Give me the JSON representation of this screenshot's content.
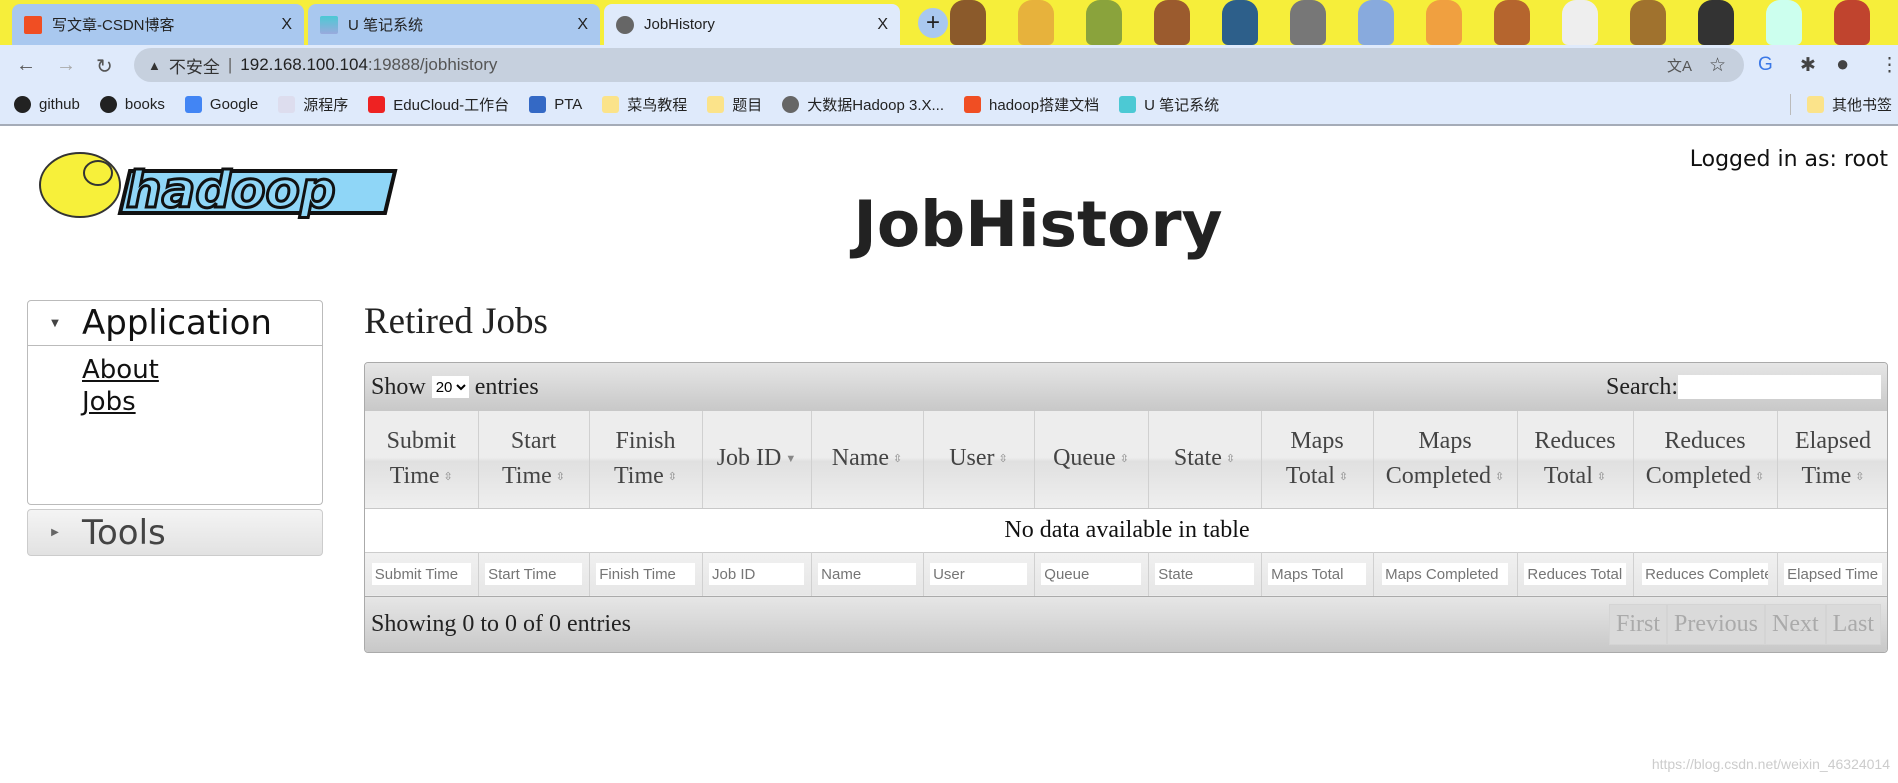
{
  "browser": {
    "tabs": [
      {
        "title": "写文章-CSDN博客",
        "favicon": "csdn-icon",
        "active": false
      },
      {
        "title": "U 笔记系统",
        "favicon": "note-icon",
        "active": false
      },
      {
        "title": "JobHistory",
        "favicon": "globe-icon",
        "active": true
      }
    ],
    "close_glyph": "X",
    "new_tab_glyph": "+",
    "security_label": "不安全",
    "url_host": "192.168.100.104",
    "url_path": ":19888/jobhistory",
    "bookmarks": [
      {
        "label": "github",
        "icon": "github-icon"
      },
      {
        "label": "books",
        "icon": "github-icon"
      },
      {
        "label": "Google",
        "icon": "google-icon"
      },
      {
        "label": "源程序",
        "icon": "app-icon"
      },
      {
        "label": "EduCloud-工作台",
        "icon": "huawei-icon"
      },
      {
        "label": "PTA",
        "icon": "pta-icon"
      },
      {
        "label": "菜鸟教程",
        "icon": "folder-icon"
      },
      {
        "label": "题目",
        "icon": "folder-icon"
      },
      {
        "label": "大数据Hadoop 3.X...",
        "icon": "globe-icon"
      },
      {
        "label": "hadoop搭建文档",
        "icon": "csdn-icon"
      },
      {
        "label": "U 笔记系统",
        "icon": "note-icon"
      }
    ],
    "other_bookmarks": "其他书签"
  },
  "header": {
    "logo_text": "hadoop",
    "title": "JobHistory",
    "logged_in": "Logged in as: root"
  },
  "sidebar": {
    "application": "Application",
    "links": [
      "About",
      "Jobs"
    ],
    "tools": "Tools"
  },
  "main": {
    "heading": "Retired Jobs",
    "show_label": "Show",
    "entries_label": "entries",
    "page_size": "20",
    "search_label": "Search:",
    "search_value": "",
    "columns": [
      "Submit Time",
      "Start Time",
      "Finish Time",
      "Job ID",
      "Name",
      "User",
      "Queue",
      "State",
      "Maps Total",
      "Maps Completed",
      "Reduces Total",
      "Reduces Completed",
      "Elapsed Time"
    ],
    "filter_placeholders": [
      "Submit Time",
      "Start Time",
      "Finish Time",
      "Job ID",
      "Name",
      "User",
      "Queue",
      "State",
      "Maps Total",
      "Maps Completed",
      "Reduces Total",
      "Reduces Completed",
      "Elapsed Time"
    ],
    "empty_message": "No data available in table",
    "info": "Showing 0 to 0 of 0 entries",
    "pager": [
      "First",
      "Previous",
      "Next",
      "Last"
    ]
  },
  "watermark": "https://blog.csdn.net/weixin_46324014",
  "colors": {
    "tab_active": "#dfeafb",
    "tab_inactive": "#a9c8ef",
    "theme_yellow": "#f6ee3a",
    "logo_blue": "#8fd6f7"
  }
}
